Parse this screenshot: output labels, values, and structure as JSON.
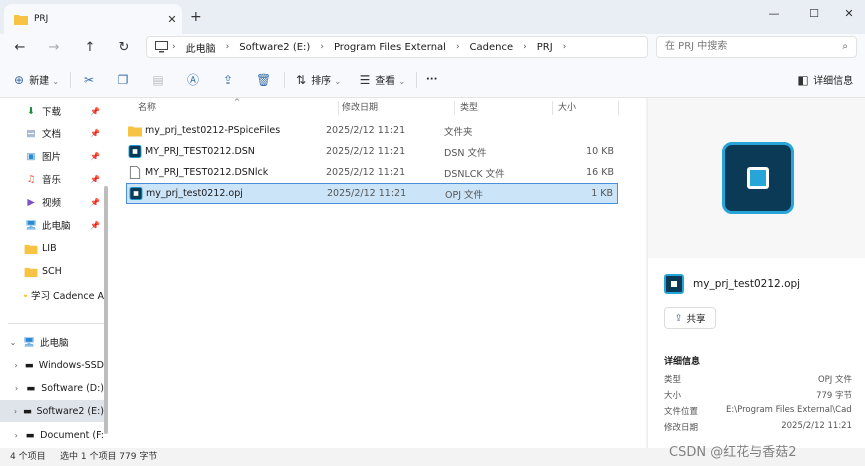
{
  "window": {
    "tab_title": "PRJ",
    "tab_close": "✕",
    "new_tab": "+",
    "min": "—",
    "max": "☐",
    "close": "✕"
  },
  "nav": {
    "back": "←",
    "forward": "→",
    "up": "↑",
    "refresh": "↻"
  },
  "address": {
    "breadcrumbs": [
      "此电脑",
      "Software2 (E:)",
      "Program Files External",
      "Cadence",
      "PRJ"
    ]
  },
  "search": {
    "placeholder": "在 PRJ 中搜索"
  },
  "toolbar": {
    "new_label": "新建",
    "sort_label": "排序",
    "view_label": "查看",
    "more_label": "···",
    "details_label": "详细信息"
  },
  "sidebar": {
    "quick": [
      {
        "label": "下载",
        "icon": "download-icon",
        "pinned": true
      },
      {
        "label": "文档",
        "icon": "document-icon",
        "pinned": true
      },
      {
        "label": "图片",
        "icon": "picture-icon",
        "pinned": true
      },
      {
        "label": "音乐",
        "icon": "music-icon",
        "pinned": true
      },
      {
        "label": "视频",
        "icon": "video-icon",
        "pinned": true
      },
      {
        "label": "此电脑",
        "icon": "computer-icon",
        "pinned": true
      },
      {
        "label": "LIB",
        "icon": "folder-icon",
        "pinned": false
      },
      {
        "label": "SCH",
        "icon": "folder-icon",
        "pinned": false
      },
      {
        "label": "学习 Cadence A",
        "icon": "folder-icon",
        "pinned": false
      }
    ],
    "tree": [
      {
        "label": "此电脑",
        "icon": "computer-icon"
      },
      {
        "label": "Windows-SSD",
        "icon": "drive-icon"
      },
      {
        "label": "Software (D:)",
        "icon": "drive-icon"
      },
      {
        "label": "Software2 (E:)",
        "icon": "drive-icon",
        "selected": true
      },
      {
        "label": "Document (F:",
        "icon": "drive-icon"
      }
    ]
  },
  "columns": {
    "name": "名称",
    "date": "修改日期",
    "type": "类型",
    "size": "大小"
  },
  "files": [
    {
      "name": "my_prj_test0212-PSpiceFiles",
      "date": "2025/2/12 11:21",
      "type": "文件夹",
      "size": "",
      "icon": "folder-icon"
    },
    {
      "name": "MY_PRJ_TEST0212.DSN",
      "date": "2025/2/12 11:21",
      "type": "DSN 文件",
      "size": "10 KB",
      "icon": "dsn-file-icon"
    },
    {
      "name": "MY_PRJ_TEST0212.DSNlck",
      "date": "2025/2/12 11:21",
      "type": "DSNLCK 文件",
      "size": "16 KB",
      "icon": "blank-file-icon"
    },
    {
      "name": "my_prj_test0212.opj",
      "date": "2025/2/12 11:21",
      "type": "OPJ 文件",
      "size": "1 KB",
      "icon": "opj-file-icon",
      "selected": true
    }
  ],
  "details": {
    "file_name": "my_prj_test0212.opj",
    "share_label": "共享",
    "heading": "详细信息",
    "props": [
      {
        "k": "类型",
        "v": "OPJ 文件"
      },
      {
        "k": "大小",
        "v": "779 字节"
      },
      {
        "k": "文件位置",
        "v": "E:\\Program Files External\\Cad..."
      },
      {
        "k": "修改日期",
        "v": "2025/2/12 11:21"
      }
    ]
  },
  "status": {
    "count": "4 个项目",
    "selection": "选中 1 个项目  779 字节"
  },
  "watermark": "CSDN @红花与香菇2"
}
